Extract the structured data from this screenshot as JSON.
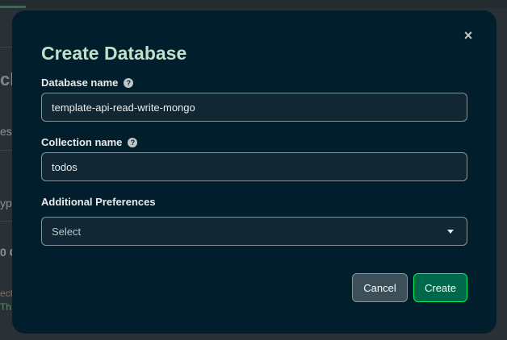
{
  "background": {
    "partial_texts": [
      "cle",
      "es",
      "ype",
      "0 C",
      "ect",
      "Th"
    ]
  },
  "modal": {
    "title": "Create Database",
    "close_glyph": "×",
    "database_name": {
      "label": "Database name",
      "help_glyph": "?",
      "value": "template-api-read-write-mongo"
    },
    "collection_name": {
      "label": "Collection name",
      "help_glyph": "?",
      "value": "todos"
    },
    "additional_preferences": {
      "label": "Additional Preferences",
      "selected": "Select"
    },
    "buttons": {
      "cancel": "Cancel",
      "create": "Create"
    }
  },
  "colors": {
    "modal_bg": "#001e2b",
    "primary_button": "#00684a",
    "primary_border": "#00ed64",
    "secondary_button": "#3d4f58"
  },
  "icons": {
    "close": "close-icon",
    "help": "question-circle-icon",
    "dropdown": "caret-down-icon"
  }
}
